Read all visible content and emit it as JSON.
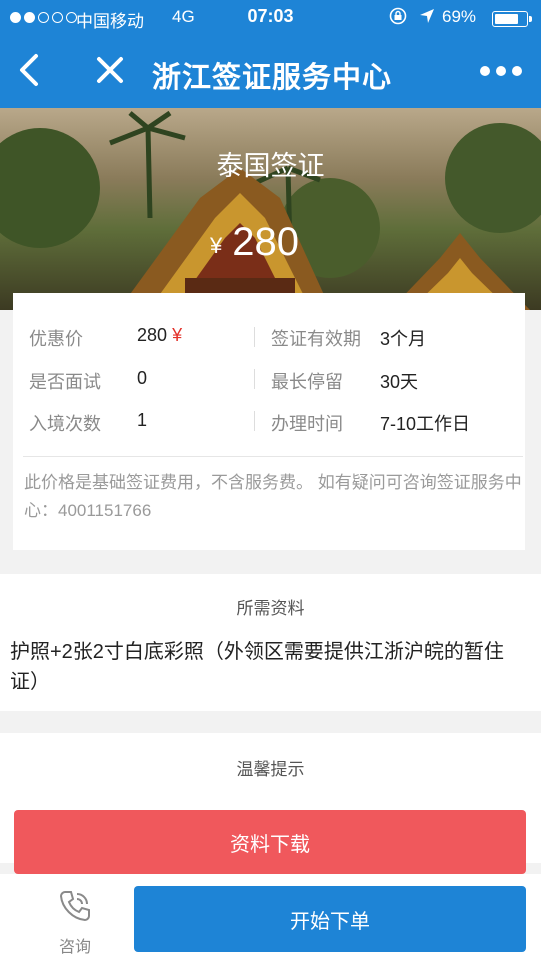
{
  "status_bar": {
    "carrier": "中国移动",
    "network": "4G",
    "time": "07:03",
    "battery_text": "69%",
    "battery_level": 0.69,
    "signal_bars_filled": 2,
    "signal_bars_total": 5
  },
  "nav": {
    "title": "浙江签证服务中心",
    "icons": [
      "back-icon",
      "close-icon",
      "more-icon"
    ]
  },
  "hero": {
    "title": "泰国签证",
    "currency": "¥",
    "price": "280"
  },
  "info": {
    "rows": [
      {
        "left_label": "优惠价",
        "left_value": "280",
        "left_unit": "¥",
        "right_label": "签证有效期",
        "right_value": "3个月"
      },
      {
        "left_label": "是否面试",
        "left_value": "0",
        "right_label": "最长停留",
        "right_value": "30天"
      },
      {
        "left_label": "入境次数",
        "left_value": "1",
        "right_label": "办理时间",
        "right_value": "7-10工作日"
      }
    ],
    "note": "此价格是基础签证费用，不含服务费。 如有疑问可咨询签证服务中心：4001151766"
  },
  "materials": {
    "heading": "所需资料",
    "content": "护照+2张2寸白底彩照（外领区需要提供江浙沪皖的暂住证）"
  },
  "tips": {
    "heading": "温馨提示"
  },
  "buttons": {
    "download": "资料下载",
    "consult": "咨询",
    "order": "开始下单"
  },
  "colors": {
    "primary": "#1e84d6",
    "danger": "#f0585c",
    "price_red": "#e3322b"
  }
}
